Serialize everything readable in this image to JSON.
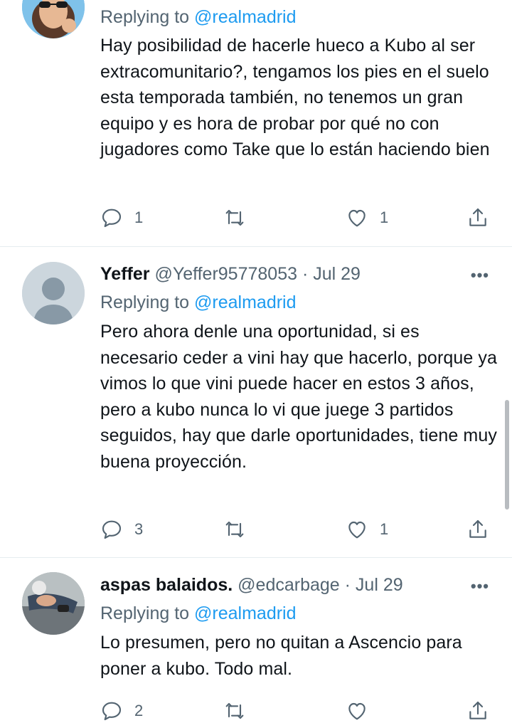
{
  "tweets": [
    {
      "reply_prefix": "Replying to",
      "reply_to": "@realmadrid",
      "text": "Hay posibilidad de hacerle hueco a Kubo al ser extracomunitario?, tengamos los pies en el suelo esta temporada también, no tenemos un gran equipo y es hora de probar por qué no con jugadores como Take que lo están haciendo bien",
      "replies": "1",
      "likes": "1"
    },
    {
      "name": "Yeffer",
      "handle": "@Yeffer95778053",
      "date": "· Jul 29",
      "reply_prefix": "Replying to",
      "reply_to": "@realmadrid",
      "text": "Pero ahora denle una oportunidad, si es necesario ceder a vini hay que hacerlo, porque ya vimos lo que vini puede hacer en estos 3 años, pero a kubo nunca lo vi que juege 3 partidos seguidos, hay que darle oportunidades, tiene muy buena proyección.",
      "replies": "3",
      "likes": "1"
    },
    {
      "name": "aspas balaidos.",
      "handle": "@edcarbage",
      "date": "· Jul 29",
      "reply_prefix": "Replying to",
      "reply_to": "@realmadrid",
      "text": "Lo presumen, pero no quitan a Ascencio para poner a kubo. Todo mal.",
      "replies": "2"
    }
  ],
  "more_glyph": "•••",
  "colors": {
    "accent": "#1d9bf0",
    "secondary": "#536471",
    "divider": "#e6ecf0"
  },
  "icons": [
    "reply-icon",
    "retweet-icon",
    "like-icon",
    "share-icon",
    "more-icon"
  ]
}
